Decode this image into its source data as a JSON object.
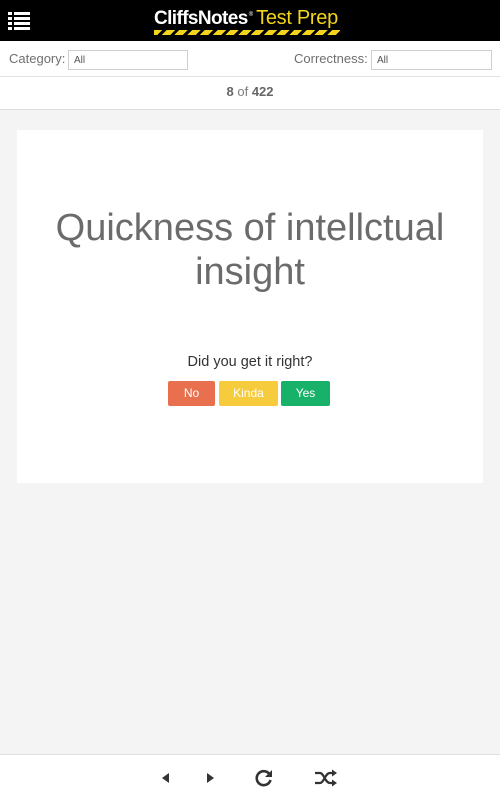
{
  "header": {
    "menu_icon": "hamburger-list-icon",
    "logo": {
      "brand": "CliffsNotes",
      "reg": "®",
      "product": "Test Prep",
      "brand_color": "#f4d41c"
    }
  },
  "filters": {
    "category": {
      "label": "Category:",
      "value": "All"
    },
    "correctness": {
      "label": "Correctness:",
      "value": "All"
    }
  },
  "counter": {
    "current": "8",
    "of": "of",
    "total": "422"
  },
  "card": {
    "term": "Quickness of intellctual insight",
    "prompt": "Did you get it right?",
    "answers": [
      {
        "label": "No",
        "color": "#e8704f"
      },
      {
        "label": "Kinda",
        "color": "#f6cb3c"
      },
      {
        "label": "Yes",
        "color": "#17b169"
      }
    ]
  },
  "footer": {
    "icons": [
      "previous-icon",
      "next-icon",
      "reload-icon",
      "shuffle-icon"
    ]
  }
}
